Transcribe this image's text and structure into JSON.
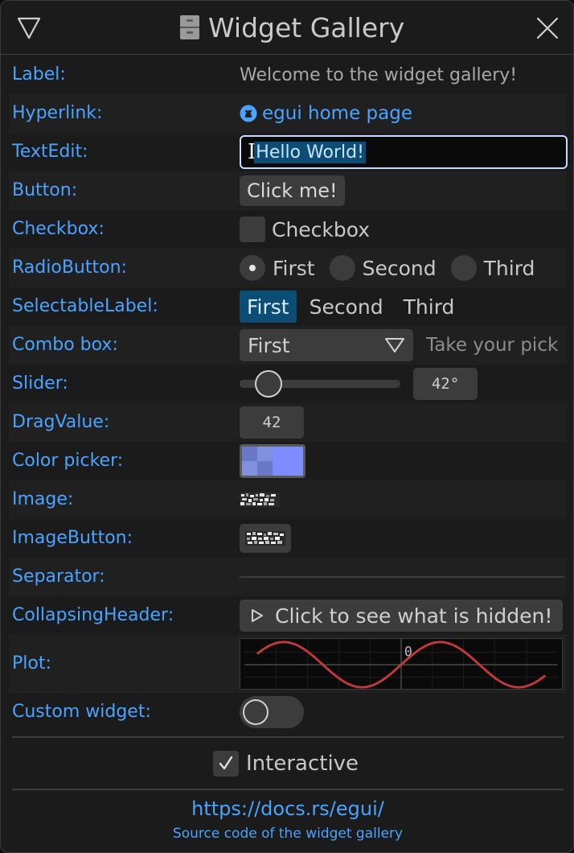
{
  "window": {
    "title": "Widget Gallery",
    "title_icon": "file-cabinet-icon",
    "collapse_icon": "triangle-down-icon",
    "close_icon": "close-icon"
  },
  "rows": {
    "label": {
      "label": "Label:",
      "text": "Welcome to the widget gallery!"
    },
    "hyperlink": {
      "label": "Hyperlink:",
      "icon": "github-icon",
      "text": "egui home page"
    },
    "textedit": {
      "label": "TextEdit:",
      "value": "Hello World!"
    },
    "button": {
      "label": "Button:",
      "text": "Click me!"
    },
    "checkbox": {
      "label": "Checkbox:",
      "text": "Checkbox",
      "checked": false
    },
    "radio": {
      "label": "RadioButton:",
      "options": [
        "First",
        "Second",
        "Third"
      ],
      "selected": "First"
    },
    "selectable": {
      "label": "SelectableLabel:",
      "options": [
        "First",
        "Second",
        "Third"
      ],
      "selected": "First"
    },
    "combo": {
      "label": "Combo box:",
      "value": "First",
      "hint": "Take your pick"
    },
    "slider": {
      "label": "Slider:",
      "value_text": "42°",
      "value": 42,
      "min": 0,
      "max": 360
    },
    "dragvalue": {
      "label": "DragValue:",
      "value": "42"
    },
    "colorpicker": {
      "label": "Color picker:",
      "color": "#7d8cff"
    },
    "image": {
      "label": "Image:"
    },
    "imagebutton": {
      "label": "ImageButton:"
    },
    "separator": {
      "label": "Separator:"
    },
    "collapsing": {
      "label": "CollapsingHeader:",
      "text": "Click to see what is hidden!"
    },
    "plot": {
      "label": "Plot:",
      "axis_label": "0",
      "line_color": "#c0393b"
    },
    "custom": {
      "label": "Custom widget:",
      "on": false
    }
  },
  "interactive": {
    "text": "Interactive",
    "checked": true
  },
  "footer": {
    "link": "https://docs.rs/egui/",
    "source": "Source code of the widget gallery"
  },
  "colors": {
    "accent": "#4aa3ff",
    "selection": "#0b4d75",
    "widget_bg": "#3c3c3c",
    "window_bg": "#1b1b1b"
  }
}
